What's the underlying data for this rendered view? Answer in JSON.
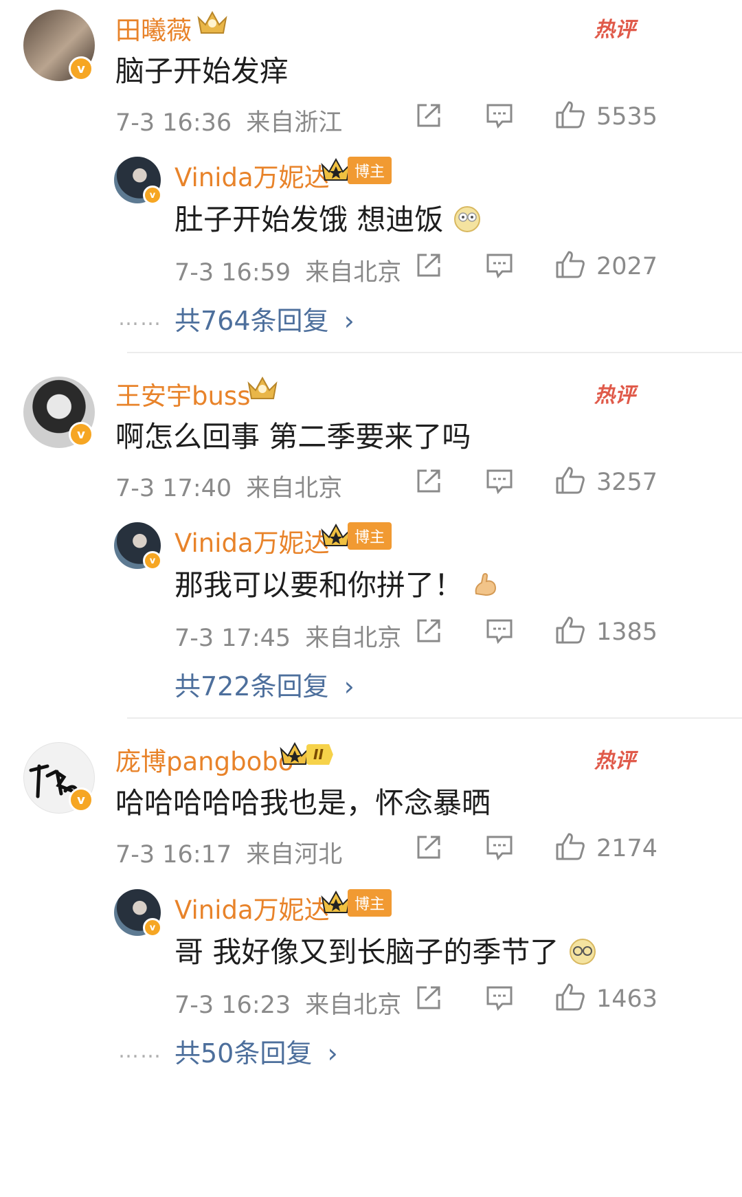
{
  "colors": {
    "username": "#e8832a",
    "reply_link": "#4d6f9c",
    "meta": "#8a8a8a",
    "hot": "#e05a4a",
    "verified_badge": "#f6a623",
    "bozhu_badge": "#f19a32"
  },
  "icons": [
    "share-icon",
    "comment-icon",
    "like-icon",
    "crown-icon",
    "chevron-right-icon",
    "emoji-icon"
  ],
  "comments": [
    {
      "user": "田曦薇",
      "hot_label": "热评",
      "text": "脑子开始发痒",
      "time": "7-3 16:36",
      "location": "来自浙江",
      "likes": "5535",
      "reply": {
        "user": "Vinida万妮达",
        "badge": "博主",
        "text": "肚子开始发饿 想迪饭",
        "time": "7-3 16:59",
        "location": "来自北京",
        "likes": "2027"
      },
      "reply_count_label": "共764条回复",
      "dots": "……"
    },
    {
      "user": "王安宇buss",
      "hot_label": "热评",
      "text": "啊怎么回事 第二季要来了吗",
      "time": "7-3 17:40",
      "location": "来自北京",
      "likes": "3257",
      "reply": {
        "user": "Vinida万妮达",
        "badge": "博主",
        "text": "那我可以要和你拼了！",
        "time": "7-3 17:45",
        "location": "来自北京",
        "likes": "1385"
      },
      "reply_count_label": "共722条回复"
    },
    {
      "user": "庞博pangbobo",
      "level_badge": "II",
      "hot_label": "热评",
      "text": "哈哈哈哈哈我也是，怀念暴晒",
      "time": "7-3 16:17",
      "location": "来自河北",
      "likes": "2174",
      "reply": {
        "user": "Vinida万妮达",
        "badge": "博主",
        "text": "哥 我好像又到长脑子的季节了",
        "time": "7-3 16:23",
        "location": "来自北京",
        "likes": "1463"
      },
      "reply_count_label": "共50条回复",
      "dots": "……"
    }
  ]
}
